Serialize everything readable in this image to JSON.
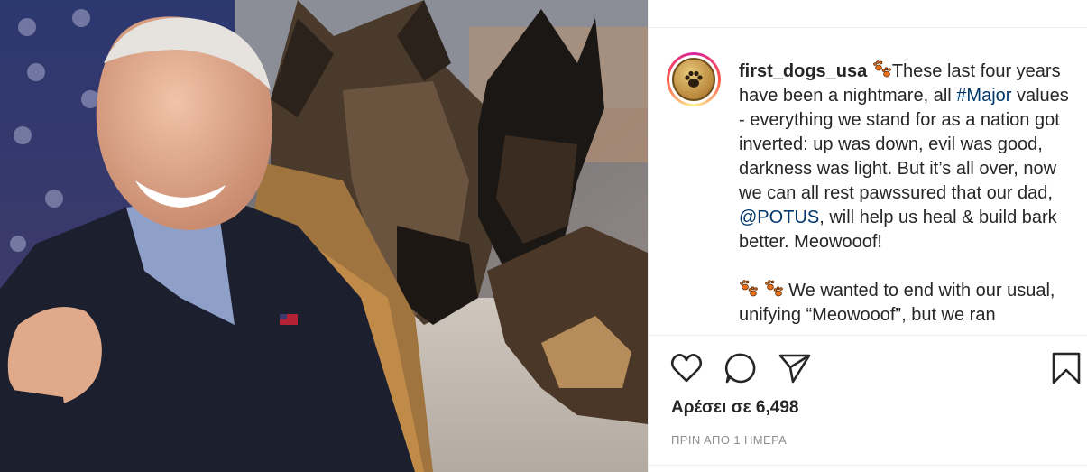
{
  "post": {
    "username": "first_dogs_usa",
    "caption_p1_a": "These last four years have been a nightmare, all ",
    "hashtag": "#Major",
    "caption_p1_b": " values - everything we stand for as a nation got inverted: up was down, evil was good, darkness was light. But it’s all over, now we can all rest pawssured that our dad, ",
    "mention": "@POTUS",
    "caption_p1_c": ", will help us heal & build bark better. Meowooof!",
    "caption_p2": " We wanted to end with our usual, unifying “Meowooof”, but we ran",
    "likes": "Αρέσει σε 6,498",
    "timestamp": "ΠΡΙΝ ΑΠΟ 1 ΗΜΕΡΑ"
  },
  "icons": {
    "like": "heart-icon",
    "comment": "comment-icon",
    "share": "share-icon",
    "save": "bookmark-icon",
    "paw": "paw-prints-icon"
  },
  "colors": {
    "link": "#00376b",
    "text": "#262626",
    "muted": "#8e8e8e",
    "paw": "#e8701a"
  }
}
